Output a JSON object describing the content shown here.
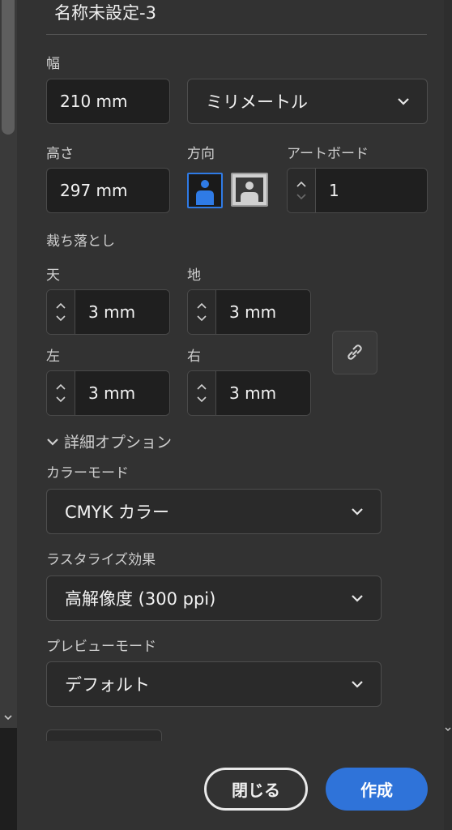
{
  "document": {
    "title": "名称未設定-3"
  },
  "width": {
    "label": "幅",
    "value": "210 mm"
  },
  "units": {
    "selected": "ミリメートル"
  },
  "height": {
    "label": "高さ",
    "value": "297 mm"
  },
  "orientation": {
    "label": "方向",
    "selected": "portrait"
  },
  "artboards": {
    "label": "アートボード",
    "value": "1"
  },
  "bleed": {
    "label": "裁ち落とし",
    "top": {
      "label": "天",
      "value": "3 mm"
    },
    "bottom": {
      "label": "地",
      "value": "3 mm"
    },
    "left": {
      "label": "左",
      "value": "3 mm"
    },
    "right": {
      "label": "右",
      "value": "3 mm"
    }
  },
  "advanced": {
    "label": "詳細オプション"
  },
  "color_mode": {
    "label": "カラーモード",
    "selected": "CMYK カラー"
  },
  "raster_effects": {
    "label": "ラスタライズ効果",
    "selected": "高解像度 (300 ppi)"
  },
  "preview_mode": {
    "label": "プレビューモード",
    "selected": "デフォルト"
  },
  "buttons": {
    "close": "閉じる",
    "create": "作成"
  },
  "colors": {
    "accent": "#2f73d9",
    "panel": "#323232",
    "field": "#1f1f1f"
  },
  "icons": [
    "chevron-down-icon",
    "chevron-up-icon",
    "link-icon",
    "portrait-icon",
    "landscape-icon"
  ]
}
